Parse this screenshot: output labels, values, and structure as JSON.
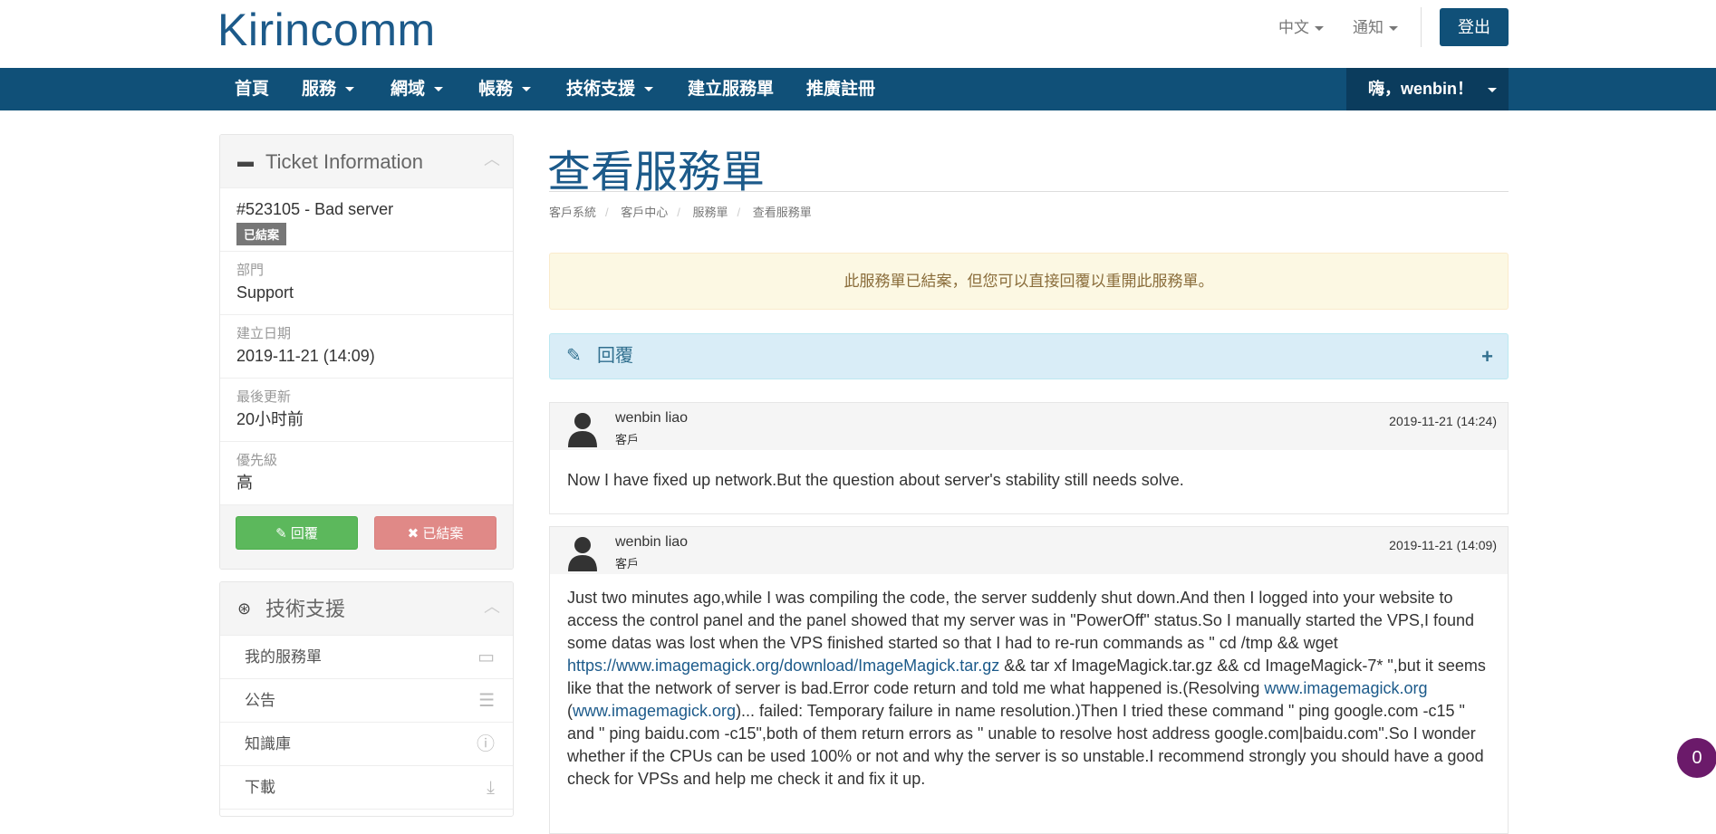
{
  "header": {
    "logo": "Kirincomm",
    "language": "中文",
    "notifications": "通知",
    "logout": "登出"
  },
  "nav": {
    "items": [
      "首頁",
      "服務",
      "網域",
      "帳務",
      "技術支援",
      "建立服務單",
      "推廣註冊"
    ],
    "user": "嗨，wenbin！"
  },
  "ticket_panel": {
    "title": "Ticket Information",
    "ticket": "#523105 - Bad server",
    "status": "已結案",
    "fields": [
      {
        "label": "部門",
        "value": "Support"
      },
      {
        "label": "建立日期",
        "value": "2019-11-21 (14:09)"
      },
      {
        "label": "最後更新",
        "value": "20小时前"
      },
      {
        "label": "優先級",
        "value": "高"
      }
    ],
    "reply_button": "回覆",
    "closed_button": "已結案"
  },
  "support_panel": {
    "title": "技術支援",
    "items": [
      "我的服務單",
      "公告",
      "知識庫",
      "下載"
    ]
  },
  "main": {
    "title": "查看服務單",
    "breadcrumb": [
      "客戶系統",
      "客戶中心",
      "服務單",
      "查看服務單"
    ],
    "alert": "此服務單已結案，但您可以直接回覆以重開此服務單。",
    "reply_label": "回覆"
  },
  "messages": [
    {
      "author": "wenbin liao",
      "role": "客戶",
      "date": "2019-11-21 (14:24)",
      "body": "Now I have fixed up network.But the question about server's stability still needs solve."
    },
    {
      "author": "wenbin liao",
      "role": "客戶",
      "date": "2019-11-21 (14:09)",
      "body_parts": [
        "Just two minutes ago,while I was compiling the code, the server suddenly shut down.And then I logged into your website to access the control panel and the panel showed that my server was in \"PowerOff\" status.So I manually started the VPS,I found some datas was lost when the VPS finished started so that I had to re-run commands as \" cd /tmp && wget ",
        "https://www.imagemagick.org/download/ImageMagick.tar.gz",
        " && tar xf ImageMagick.tar.gz && cd ImageMagick-7* \",but it seems like that the network of server is bad.Error code return and told me what happened is.(Resolving ",
        "www.imagemagick.org",
        " (",
        "www.imagemagick.org",
        ")... failed: Temporary failure in name resolution.)Then I tried these command \" ping google.com -c15 \" and \" ping baidu.com -c15\",both of them return errors as \" unable to resolve host address google.com|baidu.com\".So I wonder whether if the CPUs can be used 100% or not and why the server is so unstable.I recommend strongly you should have a good check for VPSs and help me check it and fix it up."
      ]
    }
  ],
  "chat_badge": "0"
}
